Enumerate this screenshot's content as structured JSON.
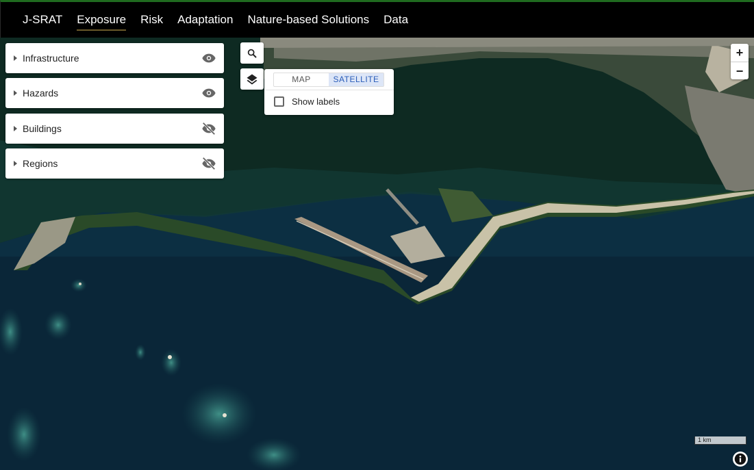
{
  "nav": {
    "brand": "J-SRAT",
    "items": [
      "Exposure",
      "Risk",
      "Adaptation",
      "Nature-based Solutions",
      "Data"
    ],
    "active": "Exposure"
  },
  "sidebar": {
    "panels": [
      {
        "label": "Infrastructure",
        "visible": true
      },
      {
        "label": "Hazards",
        "visible": true
      },
      {
        "label": "Buildings",
        "visible": false
      },
      {
        "label": "Regions",
        "visible": false
      }
    ]
  },
  "basemap": {
    "options": [
      "MAP",
      "SATELLITE"
    ],
    "selected": "SATELLITE",
    "show_labels": "Show labels"
  },
  "zoom": {
    "in": "+",
    "out": "−"
  },
  "scale": {
    "label": "1 km"
  },
  "icons": {
    "search": "search-icon",
    "layers": "layers-icon",
    "visible": "eye-icon",
    "hidden": "eye-off-icon",
    "info": "info-icon"
  },
  "colors": {
    "accent_top": "#1f6b1f",
    "selected_bg": "#dde6f7",
    "selected_text": "#2a5cb8"
  }
}
